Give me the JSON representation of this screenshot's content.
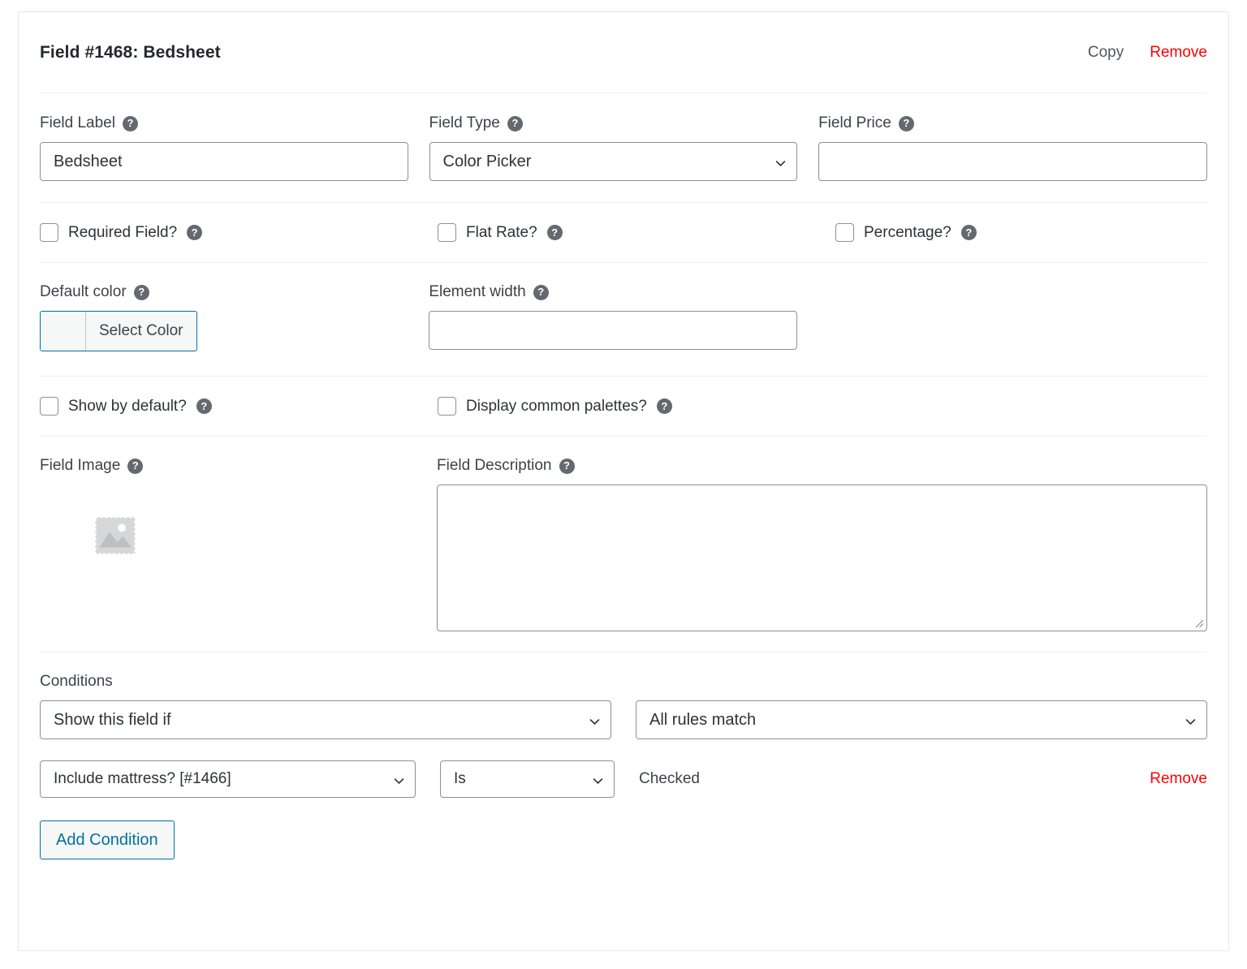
{
  "header": {
    "title": "Field #1468: Bedsheet",
    "copy_label": "Copy",
    "remove_label": "Remove"
  },
  "row_basic": {
    "field_label": {
      "label": "Field Label",
      "value": "Bedsheet",
      "placeholder": ""
    },
    "field_type": {
      "label": "Field Type",
      "value": "Color Picker"
    },
    "field_price": {
      "label": "Field Price",
      "value": "",
      "placeholder": ""
    }
  },
  "row_checks_1": [
    {
      "label": "Required Field?",
      "checked": false,
      "help": true
    },
    {
      "label": "Flat Rate?",
      "checked": false,
      "help": true
    },
    {
      "label": "Percentage?",
      "checked": false,
      "help": true
    }
  ],
  "row_color": {
    "default_color": {
      "label": "Default color",
      "button_label": "Select Color",
      "swatch_color": "#f6f7f7"
    },
    "element_width": {
      "label": "Element width",
      "value": "",
      "placeholder": ""
    }
  },
  "row_checks_2": [
    {
      "label": "Show by default?",
      "checked": false,
      "help": true
    },
    {
      "label": "Display common palettes?",
      "checked": false,
      "help": true
    }
  ],
  "row_media": {
    "field_image": {
      "label": "Field Image",
      "icon": "image-placeholder-icon"
    },
    "field_description": {
      "label": "Field Description",
      "value": "",
      "placeholder": ""
    }
  },
  "conditions": {
    "label": "Conditions",
    "action_select": "Show this field if",
    "match_select": "All rules match",
    "rules": [
      {
        "field_select": "Include mattress? [#1466]",
        "operator_select": "Is",
        "value_text": "Checked",
        "remove_label": "Remove"
      }
    ],
    "add_button_label": "Add Condition"
  },
  "colors": {
    "accent_blue": "#0071a1",
    "danger_red": "#ff0000",
    "border_gray": "#8c8f94",
    "help_gray": "#646970"
  }
}
